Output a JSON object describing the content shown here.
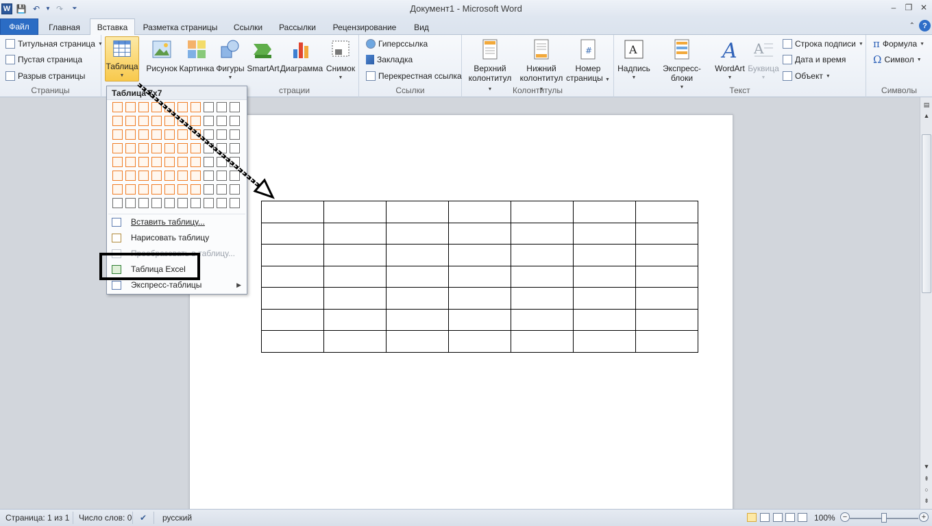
{
  "titlebar": {
    "title": "Документ1 - Microsoft Word",
    "logo": "W"
  },
  "tabs": [
    "Файл",
    "Главная",
    "Вставка",
    "Разметка страницы",
    "Ссылки",
    "Рассылки",
    "Рецензирование",
    "Вид"
  ],
  "ribbon": {
    "pages_group": {
      "label": "Страницы",
      "items": [
        "Титульная страница",
        "Пустая страница",
        "Разрыв страницы"
      ]
    },
    "tables_group": {
      "button": "Таблица"
    },
    "illustrations_group": {
      "label_partial": "страции",
      "items": [
        "Рисунок",
        "Картинка",
        "Фигуры",
        "SmartArt",
        "Диаграмма",
        "Снимок"
      ]
    },
    "links_group": {
      "label": "Ссылки",
      "items": [
        "Гиперссылка",
        "Закладка",
        "Перекрестная ссылка"
      ]
    },
    "header_footer_group": {
      "label": "Колонтитулы",
      "header": [
        "Верхний",
        "колонтитул"
      ],
      "footer": [
        "Нижний",
        "колонтитул"
      ],
      "pagenum": [
        "Номер",
        "страницы"
      ]
    },
    "text_group": {
      "label": "Текст",
      "items": [
        "Надпись",
        "Экспресс-блоки",
        "WordArt",
        "Буквица"
      ],
      "small": [
        "Строка подписи",
        "Дата и время",
        "Объект"
      ]
    },
    "symbols_group": {
      "label": "Символы",
      "items": [
        "Формула",
        "Символ"
      ]
    }
  },
  "dropdown": {
    "header": "Таблица 7x7",
    "items": [
      {
        "label": "Вставить таблицу...",
        "enabled": true
      },
      {
        "label": "Нарисовать таблицу",
        "enabled": true
      },
      {
        "label": "Преобразовать в таблицу...",
        "enabled": false
      },
      {
        "label": "Таблица Excel",
        "enabled": true
      },
      {
        "label": "Экспресс-таблицы",
        "enabled": true
      }
    ],
    "grid": {
      "cols": 10,
      "rows": 8,
      "selected_cols": 7,
      "selected_rows": 7
    }
  },
  "document": {
    "table": {
      "rows": 7,
      "cols": 7
    }
  },
  "statusbar": {
    "page": "Страница: 1 из 1",
    "words": "Число слов: 0",
    "language": "русский",
    "zoom": "100%"
  }
}
